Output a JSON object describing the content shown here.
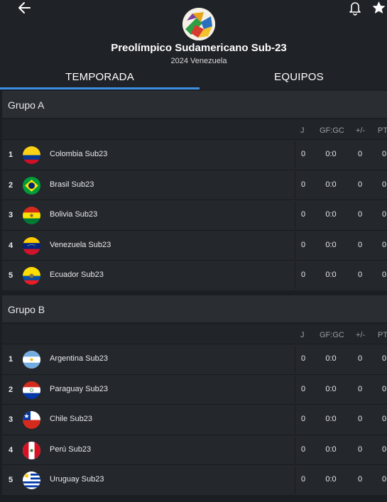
{
  "header": {
    "title": "Preolímpico Sudamericano Sub-23",
    "subtitle": "2024 Venezuela"
  },
  "icons": {
    "back": "arrow-left-icon",
    "notifications": "bell-icon",
    "favorite": "star-icon"
  },
  "tabs": [
    {
      "label": "TEMPORADA",
      "active": true
    },
    {
      "label": "EQUIPOS",
      "active": false
    }
  ],
  "columns": {
    "j": "J",
    "gfgc": "GF:GC",
    "diff": "+/-",
    "pts": "PT"
  },
  "colors": {
    "accent": "#3d8fe0",
    "background": "#1b1e22",
    "row": "#24272b"
  },
  "groups": [
    {
      "title": "Grupo A",
      "rows": [
        {
          "pos": "1",
          "team": "Colombia Sub23",
          "j": "0",
          "gfgc": "0:0",
          "diff": "0",
          "pts": "0"
        },
        {
          "pos": "2",
          "team": "Brasil Sub23",
          "j": "0",
          "gfgc": "0:0",
          "diff": "0",
          "pts": "0"
        },
        {
          "pos": "3",
          "team": "Bolivia Sub23",
          "j": "0",
          "gfgc": "0:0",
          "diff": "0",
          "pts": "0"
        },
        {
          "pos": "4",
          "team": "Venezuela Sub23",
          "j": "0",
          "gfgc": "0:0",
          "diff": "0",
          "pts": "0"
        },
        {
          "pos": "5",
          "team": "Ecuador Sub23",
          "j": "0",
          "gfgc": "0:0",
          "diff": "0",
          "pts": "0"
        }
      ]
    },
    {
      "title": "Grupo B",
      "rows": [
        {
          "pos": "1",
          "team": "Argentina Sub23",
          "j": "0",
          "gfgc": "0:0",
          "diff": "0",
          "pts": "0"
        },
        {
          "pos": "2",
          "team": "Paraguay Sub23",
          "j": "0",
          "gfgc": "0:0",
          "diff": "0",
          "pts": "0"
        },
        {
          "pos": "3",
          "team": "Chile Sub23",
          "j": "0",
          "gfgc": "0:0",
          "diff": "0",
          "pts": "0"
        },
        {
          "pos": "4",
          "team": "Perú Sub23",
          "j": "0",
          "gfgc": "0:0",
          "diff": "0",
          "pts": "0"
        },
        {
          "pos": "5",
          "team": "Uruguay Sub23",
          "j": "0",
          "gfgc": "0:0",
          "diff": "0",
          "pts": "0"
        }
      ]
    }
  ]
}
